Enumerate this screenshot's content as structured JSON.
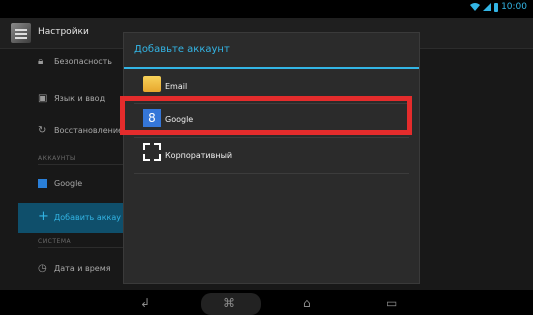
{
  "status_bar": {
    "time": "10:00"
  },
  "action_bar": {
    "title": "Настройки"
  },
  "settings": {
    "security": "Безопасность",
    "language": "Язык и ввод",
    "restore": "Восстановление",
    "accounts_section": "АККАУНТЫ",
    "google": "Google",
    "add_account": "Добавить аккау",
    "system_section": "СИСТЕМА",
    "date_time": "Дата и время"
  },
  "dialog": {
    "title": "Добавьте аккаунт",
    "options": [
      {
        "label": "Email",
        "icon": "email-icon"
      },
      {
        "label": "Google",
        "icon": "google-icon"
      },
      {
        "label": "Корпоративный",
        "icon": "corporate-icon"
      }
    ]
  },
  "nav_bar": {
    "buttons": [
      "back",
      "home",
      "recents"
    ]
  }
}
